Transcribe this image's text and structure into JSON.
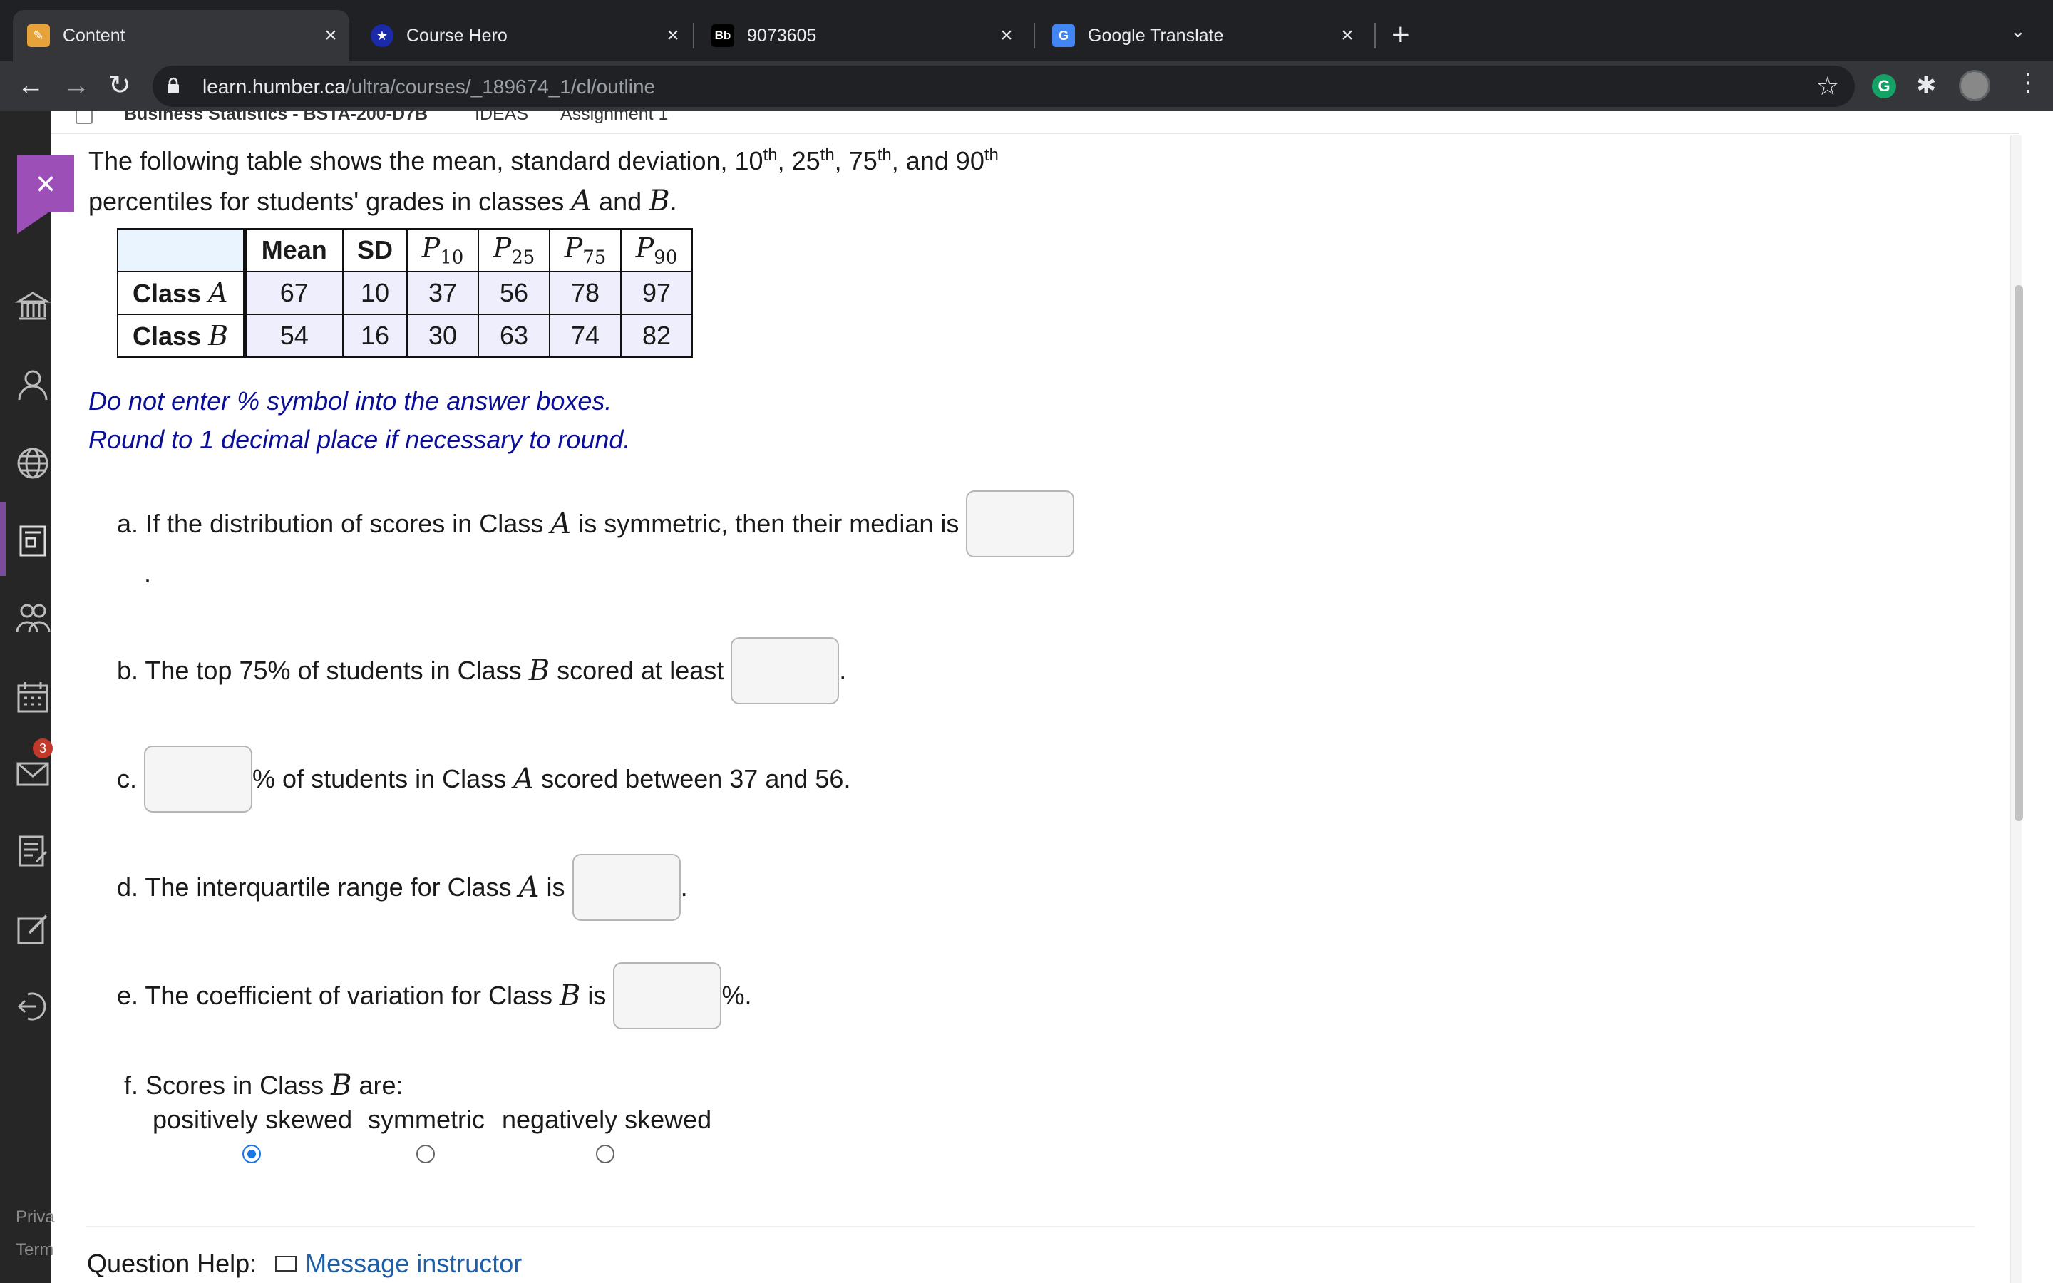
{
  "browser": {
    "tabs": [
      {
        "title": "Content",
        "favicon": "pencil-icon",
        "active": true
      },
      {
        "title": "Course Hero",
        "favicon": "star-icon",
        "active": false
      },
      {
        "title": "9073605",
        "favicon": "Bb",
        "active": false
      },
      {
        "title": "Google Translate",
        "favicon": "translate-icon",
        "active": false
      }
    ],
    "url_host": "learn.humber.ca",
    "url_path": "/ultra/courses/_189674_1/cl/outline",
    "extension_letter": "G"
  },
  "breadcrumb": {
    "course": "Business Statistics - BSTA-200-D7B",
    "section": "IDEAS",
    "item": "Assignment 1"
  },
  "sidebar": {
    "notification_count": "3",
    "footer_privacy": "Priva",
    "footer_terms": "Term"
  },
  "question": {
    "intro_a": "The following table shows the mean, standard deviation, 10",
    "sup_th": "th",
    "intro_b": ", 25",
    "intro_c": ", 75",
    "intro_d": ", and 90",
    "intro_e": "percentiles for students' grades in classes",
    "var_A": "A",
    "and": "and",
    "var_B": "B",
    "period": "."
  },
  "table": {
    "headers": [
      "Mean",
      "SD"
    ],
    "percentile_symbol": "P",
    "percentiles": [
      "10",
      "25",
      "75",
      "90"
    ],
    "row_prefix": "Class",
    "rows": [
      {
        "class": "A",
        "values": [
          "67",
          "10",
          "37",
          "56",
          "78",
          "97"
        ]
      },
      {
        "class": "B",
        "values": [
          "54",
          "16",
          "30",
          "63",
          "74",
          "82"
        ]
      }
    ]
  },
  "notes": {
    "line1": "Do not enter % symbol into the answer boxes.",
    "line2": "Round to 1 decimal place if necessary to round."
  },
  "parts": {
    "a_text": "a. If the distribution of scores in Class",
    "a_text2": "is symmetric, then their median is",
    "a_after": ".",
    "b_text": "b. The top 75% of students in Class",
    "b_text2": "scored at least",
    "b_after": ".",
    "c_label": "c.",
    "c_text": "% of students in Class",
    "c_text2": "scored between 37 and 56.",
    "d_text": "d. The interquartile range for Class",
    "d_text2": "is",
    "d_after": ".",
    "e_text": "e. The coefficient of variation for Class",
    "e_text2": "is",
    "e_after": "%.",
    "f_text": "f. Scores in Class",
    "f_text2": "are:"
  },
  "options": {
    "items": [
      "positively skewed",
      "symmetric",
      "negatively skewed"
    ],
    "selected_index": 0
  },
  "help": {
    "label": "Question Help:",
    "link": "Message instructor"
  },
  "colors": {
    "note_blue": "#0b0e96",
    "link_blue": "#1f5fa6",
    "accent_purple": "#9c4fb7",
    "radio_selected": "#1a73e8",
    "table_cell": "#efeefd"
  }
}
